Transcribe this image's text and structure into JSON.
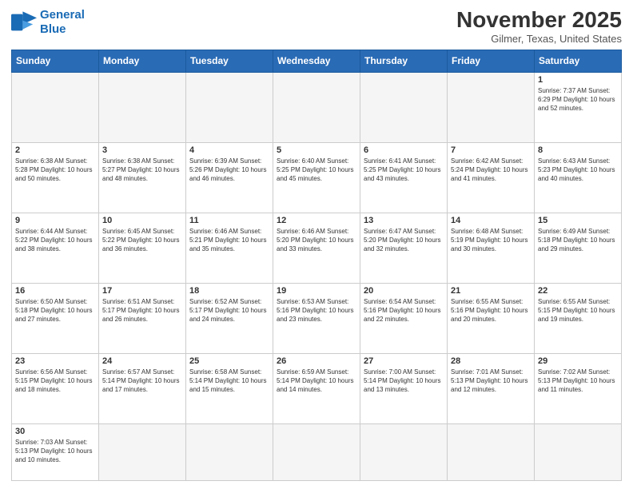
{
  "logo": {
    "line1": "General",
    "line2": "Blue"
  },
  "header": {
    "month_year": "November 2025",
    "location": "Gilmer, Texas, United States"
  },
  "days_of_week": [
    "Sunday",
    "Monday",
    "Tuesday",
    "Wednesday",
    "Thursday",
    "Friday",
    "Saturday"
  ],
  "weeks": [
    [
      {
        "day": "",
        "info": ""
      },
      {
        "day": "",
        "info": ""
      },
      {
        "day": "",
        "info": ""
      },
      {
        "day": "",
        "info": ""
      },
      {
        "day": "",
        "info": ""
      },
      {
        "day": "",
        "info": ""
      },
      {
        "day": "1",
        "info": "Sunrise: 7:37 AM\nSunset: 6:29 PM\nDaylight: 10 hours and 52 minutes."
      }
    ],
    [
      {
        "day": "2",
        "info": "Sunrise: 6:38 AM\nSunset: 5:28 PM\nDaylight: 10 hours and 50 minutes."
      },
      {
        "day": "3",
        "info": "Sunrise: 6:38 AM\nSunset: 5:27 PM\nDaylight: 10 hours and 48 minutes."
      },
      {
        "day": "4",
        "info": "Sunrise: 6:39 AM\nSunset: 5:26 PM\nDaylight: 10 hours and 46 minutes."
      },
      {
        "day": "5",
        "info": "Sunrise: 6:40 AM\nSunset: 5:25 PM\nDaylight: 10 hours and 45 minutes."
      },
      {
        "day": "6",
        "info": "Sunrise: 6:41 AM\nSunset: 5:25 PM\nDaylight: 10 hours and 43 minutes."
      },
      {
        "day": "7",
        "info": "Sunrise: 6:42 AM\nSunset: 5:24 PM\nDaylight: 10 hours and 41 minutes."
      },
      {
        "day": "8",
        "info": "Sunrise: 6:43 AM\nSunset: 5:23 PM\nDaylight: 10 hours and 40 minutes."
      }
    ],
    [
      {
        "day": "9",
        "info": "Sunrise: 6:44 AM\nSunset: 5:22 PM\nDaylight: 10 hours and 38 minutes."
      },
      {
        "day": "10",
        "info": "Sunrise: 6:45 AM\nSunset: 5:22 PM\nDaylight: 10 hours and 36 minutes."
      },
      {
        "day": "11",
        "info": "Sunrise: 6:46 AM\nSunset: 5:21 PM\nDaylight: 10 hours and 35 minutes."
      },
      {
        "day": "12",
        "info": "Sunrise: 6:46 AM\nSunset: 5:20 PM\nDaylight: 10 hours and 33 minutes."
      },
      {
        "day": "13",
        "info": "Sunrise: 6:47 AM\nSunset: 5:20 PM\nDaylight: 10 hours and 32 minutes."
      },
      {
        "day": "14",
        "info": "Sunrise: 6:48 AM\nSunset: 5:19 PM\nDaylight: 10 hours and 30 minutes."
      },
      {
        "day": "15",
        "info": "Sunrise: 6:49 AM\nSunset: 5:18 PM\nDaylight: 10 hours and 29 minutes."
      }
    ],
    [
      {
        "day": "16",
        "info": "Sunrise: 6:50 AM\nSunset: 5:18 PM\nDaylight: 10 hours and 27 minutes."
      },
      {
        "day": "17",
        "info": "Sunrise: 6:51 AM\nSunset: 5:17 PM\nDaylight: 10 hours and 26 minutes."
      },
      {
        "day": "18",
        "info": "Sunrise: 6:52 AM\nSunset: 5:17 PM\nDaylight: 10 hours and 24 minutes."
      },
      {
        "day": "19",
        "info": "Sunrise: 6:53 AM\nSunset: 5:16 PM\nDaylight: 10 hours and 23 minutes."
      },
      {
        "day": "20",
        "info": "Sunrise: 6:54 AM\nSunset: 5:16 PM\nDaylight: 10 hours and 22 minutes."
      },
      {
        "day": "21",
        "info": "Sunrise: 6:55 AM\nSunset: 5:16 PM\nDaylight: 10 hours and 20 minutes."
      },
      {
        "day": "22",
        "info": "Sunrise: 6:55 AM\nSunset: 5:15 PM\nDaylight: 10 hours and 19 minutes."
      }
    ],
    [
      {
        "day": "23",
        "info": "Sunrise: 6:56 AM\nSunset: 5:15 PM\nDaylight: 10 hours and 18 minutes."
      },
      {
        "day": "24",
        "info": "Sunrise: 6:57 AM\nSunset: 5:14 PM\nDaylight: 10 hours and 17 minutes."
      },
      {
        "day": "25",
        "info": "Sunrise: 6:58 AM\nSunset: 5:14 PM\nDaylight: 10 hours and 15 minutes."
      },
      {
        "day": "26",
        "info": "Sunrise: 6:59 AM\nSunset: 5:14 PM\nDaylight: 10 hours and 14 minutes."
      },
      {
        "day": "27",
        "info": "Sunrise: 7:00 AM\nSunset: 5:14 PM\nDaylight: 10 hours and 13 minutes."
      },
      {
        "day": "28",
        "info": "Sunrise: 7:01 AM\nSunset: 5:13 PM\nDaylight: 10 hours and 12 minutes."
      },
      {
        "day": "29",
        "info": "Sunrise: 7:02 AM\nSunset: 5:13 PM\nDaylight: 10 hours and 11 minutes."
      }
    ],
    [
      {
        "day": "30",
        "info": "Sunrise: 7:03 AM\nSunset: 5:13 PM\nDaylight: 10 hours and 10 minutes."
      },
      {
        "day": "",
        "info": ""
      },
      {
        "day": "",
        "info": ""
      },
      {
        "day": "",
        "info": ""
      },
      {
        "day": "",
        "info": ""
      },
      {
        "day": "",
        "info": ""
      },
      {
        "day": "",
        "info": ""
      }
    ]
  ]
}
